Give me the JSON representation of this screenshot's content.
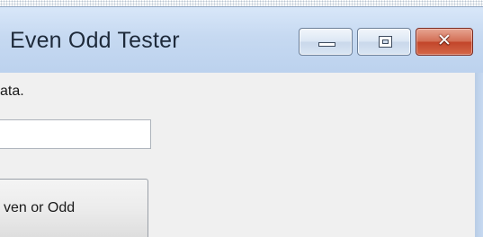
{
  "window": {
    "title": "Even Odd Tester",
    "controls": {
      "minimize_icon": "minimize-icon",
      "maximize_icon": "maximize-icon",
      "close_icon": "close-icon",
      "close_glyph": "✕"
    },
    "colors": {
      "titlebar": "#c6d9f1",
      "client": "#f0f0f0",
      "close_button": "#c2452a"
    }
  },
  "form": {
    "prompt": "ata.",
    "input": {
      "value": "",
      "placeholder": ""
    },
    "button_label": "ven or Odd"
  }
}
